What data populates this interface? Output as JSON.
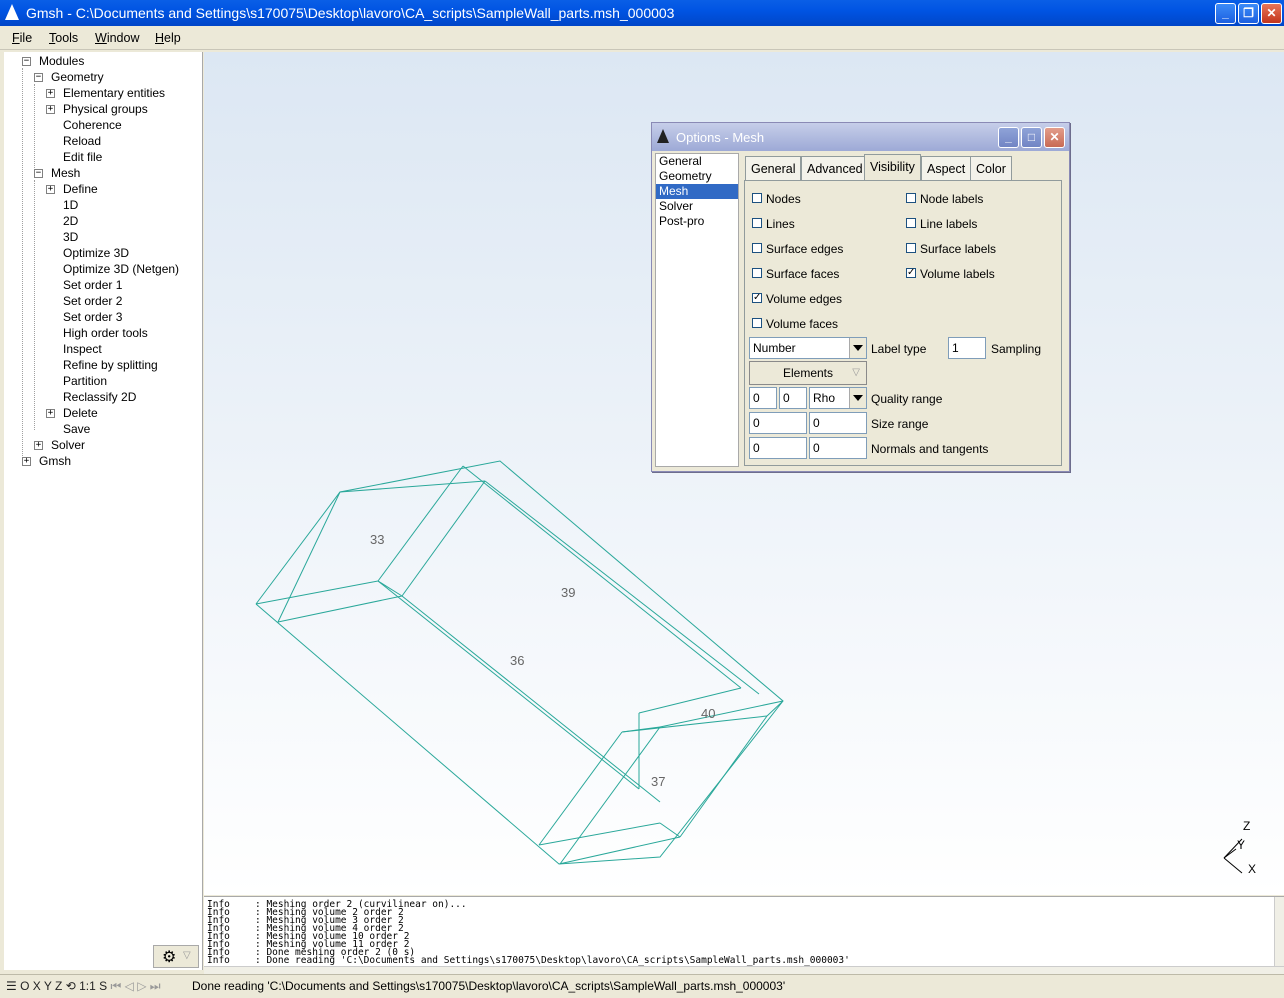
{
  "window": {
    "title": "Gmsh - C:\\Documents and Settings\\s170075\\Desktop\\lavoro\\CA_scripts\\SampleWall_parts.msh_000003"
  },
  "menu": [
    {
      "label": "File",
      "accel": "F",
      "rest": "ile"
    },
    {
      "label": "Tools",
      "accel": "T",
      "rest": "ools"
    },
    {
      "label": "Window",
      "accel": "W",
      "rest": "indow"
    },
    {
      "label": "Help",
      "accel": "H",
      "rest": "elp"
    }
  ],
  "tree": {
    "modules": "Modules",
    "geometry": "Geometry",
    "geometry_items": [
      "Elementary entities",
      "Physical groups",
      "Coherence",
      "Reload",
      "Edit file"
    ],
    "mesh": "Mesh",
    "mesh_items": [
      "Define",
      "1D",
      "2D",
      "3D",
      "Optimize 3D",
      "Optimize 3D (Netgen)",
      "Set order 1",
      "Set order 2",
      "Set order 3",
      "High order tools",
      "Inspect",
      "Refine by splitting",
      "Partition",
      "Reclassify 2D",
      "Delete",
      "Save"
    ],
    "solver": "Solver",
    "gmsh": "Gmsh"
  },
  "dialog": {
    "title": "Options - Mesh",
    "categories": [
      "General",
      "Geometry",
      "Mesh",
      "Solver",
      "Post-pro"
    ],
    "selected_category": "Mesh",
    "tabs": [
      "General",
      "Advanced",
      "Visibility",
      "Aspect",
      "Color"
    ],
    "active_tab": "Visibility",
    "checkboxes": {
      "nodes": {
        "label": "Nodes",
        "checked": false
      },
      "lines": {
        "label": "Lines",
        "checked": false
      },
      "surface_edges": {
        "label": "Surface edges",
        "checked": false
      },
      "surface_faces": {
        "label": "Surface faces",
        "checked": false
      },
      "volume_edges": {
        "label": "Volume edges",
        "checked": true
      },
      "volume_faces": {
        "label": "Volume faces",
        "checked": false
      },
      "node_labels": {
        "label": "Node labels",
        "checked": false
      },
      "line_labels": {
        "label": "Line labels",
        "checked": false
      },
      "surface_labels": {
        "label": "Surface labels",
        "checked": false
      },
      "volume_labels": {
        "label": "Volume labels",
        "checked": true
      }
    },
    "label_type_value": "Number",
    "label_type_label": "Label type",
    "sampling_value": "1",
    "sampling_label": "Sampling",
    "elements_button": "Elements",
    "quality_min": "0",
    "quality_max": "0",
    "quality_type": "Rho",
    "quality_label": "Quality range",
    "size_min": "0",
    "size_max": "0",
    "size_label": "Size range",
    "normals_value": "0",
    "tangents_value": "0",
    "normals_label": "Normals and tangents"
  },
  "viewport": {
    "mesh_color": "#2aa89a",
    "volume_labels": [
      "33",
      "39",
      "36",
      "40",
      "37"
    ],
    "axes": {
      "z": "Z",
      "y": "Y",
      "x": "X"
    }
  },
  "messages": [
    {
      "level": "Info",
      "text": ": Meshing order 2 (curvilinear on)..."
    },
    {
      "level": "Info",
      "text": ": Meshing volume 2 order 2"
    },
    {
      "level": "Info",
      "text": ": Meshing volume 3 order 2"
    },
    {
      "level": "Info",
      "text": ": Meshing volume 4 order 2"
    },
    {
      "level": "Info",
      "text": ": Meshing volume 10 order 2"
    },
    {
      "level": "Info",
      "text": ": Meshing volume 11 order 2"
    },
    {
      "level": "Info",
      "text": ": Done meshing order 2 (0 s)"
    },
    {
      "level": "Info",
      "text": ": Done reading 'C:\\Documents and Settings\\s170075\\Desktop\\lavoro\\CA_scripts\\SampleWall_parts.msh_000003'"
    }
  ],
  "statusbar": {
    "tools": "O X Y Z",
    "scale": "1:1",
    "s": "S",
    "text": "Done reading 'C:\\Documents and Settings\\s170075\\Desktop\\lavoro\\CA_scripts\\SampleWall_parts.msh_000003'"
  }
}
